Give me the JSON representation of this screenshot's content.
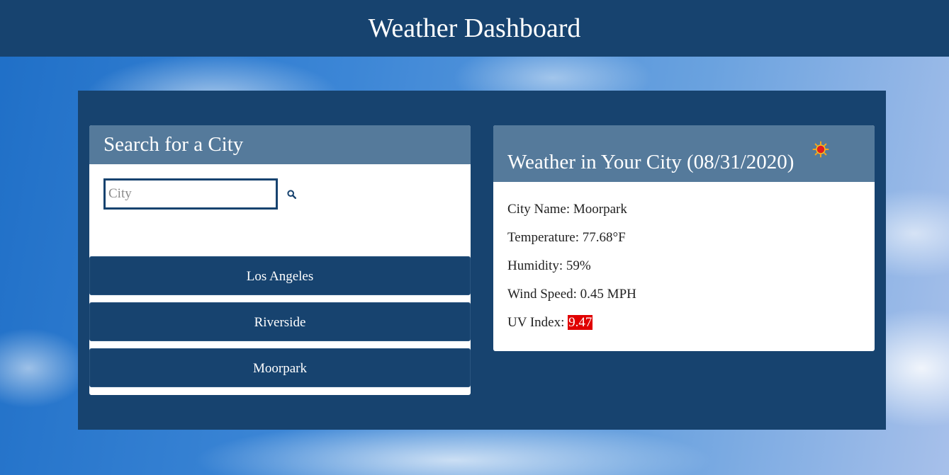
{
  "header": {
    "title": "Weather Dashboard"
  },
  "search": {
    "title": "Search for a City",
    "placeholder": "City",
    "value": "",
    "search_icon": "search-icon",
    "history": [
      "Los Angeles",
      "Riverside",
      "Moorpark"
    ]
  },
  "weather": {
    "title": "Weather in Your City (08/31/2020)",
    "icon": "sun-icon",
    "city_label": "City Name:",
    "city": "Moorpark",
    "temp_label": "Temperature:",
    "temp": "77.68°F",
    "humidity_label": "Humidity:",
    "humidity": "59%",
    "wind_label": "Wind Speed:",
    "wind": "0.45 MPH",
    "uv_label": "UV Index:",
    "uv": "9.47",
    "uv_color": "#e00000"
  },
  "colors": {
    "primary": "#17436f",
    "card_header": "#557a9b"
  }
}
